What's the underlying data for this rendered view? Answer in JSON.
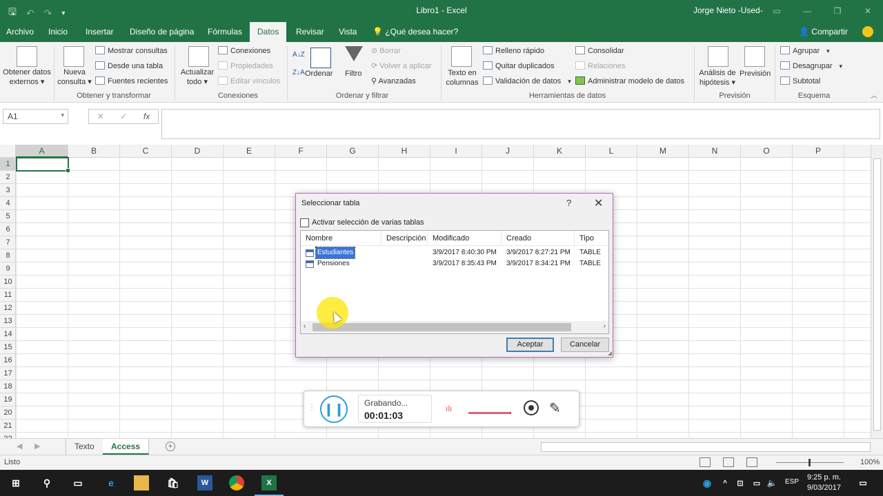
{
  "window": {
    "title": "Libro1  -  Excel",
    "user": "Jorge Nieto -Used-"
  },
  "menu": {
    "tabs": [
      "Archivo",
      "Inicio",
      "Insertar",
      "Diseño de página",
      "Fórmulas",
      "Datos",
      "Revisar",
      "Vista"
    ],
    "active_tab": "Datos",
    "tell_me": "¿Qué desea hacer?",
    "share": "Compartir"
  },
  "ribbon": {
    "get_external": [
      "Obtener datos",
      "externos ▾"
    ],
    "new_query": [
      "Nueva",
      "consulta ▾"
    ],
    "show_queries": "Mostrar consultas",
    "from_table": "Desde una tabla",
    "recent_sources": "Fuentes recientes",
    "group_get_transform": "Obtener y transformar",
    "refresh_all": [
      "Actualizar",
      "todo ▾"
    ],
    "connections": "Conexiones",
    "properties": "Propiedades",
    "edit_links": "Editar vínculos",
    "group_connections": "Conexiones",
    "sort": "Ordenar",
    "filter": "Filtro",
    "clear": "Borrar",
    "reapply": "Volver a aplicar",
    "advanced": "Avanzadas",
    "group_sort_filter": "Ordenar y filtrar",
    "text_to_columns": [
      "Texto en",
      "columnas"
    ],
    "flash_fill": "Relleno rápido",
    "remove_duplicates": "Quitar duplicados",
    "data_validation": "Validación de datos",
    "consolidate": "Consolidar",
    "relationships": "Relaciones",
    "manage_model": "Administrar modelo de datos",
    "group_data_tools": "Herramientas de datos",
    "what_if": [
      "Análisis de",
      "hipótesis ▾"
    ],
    "forecast_sheet": "Previsión",
    "group_forecast": "Previsión",
    "group": "Agrupar",
    "ungroup": "Desagrupar",
    "subtotal": "Subtotal",
    "group_outline": "Esquema"
  },
  "formula_bar": {
    "name_box": "A1",
    "fx": "fx",
    "content": ""
  },
  "grid": {
    "columns": [
      "A",
      "B",
      "C",
      "D",
      "E",
      "F",
      "G",
      "H",
      "I",
      "J",
      "K",
      "L",
      "M",
      "N",
      "O",
      "P"
    ],
    "rows": [
      "1",
      "2",
      "3",
      "4",
      "5",
      "6",
      "7",
      "8",
      "9",
      "10",
      "11",
      "12",
      "13",
      "14",
      "15",
      "16",
      "17",
      "18",
      "19",
      "20",
      "21",
      "22"
    ]
  },
  "sheets": {
    "tabs": [
      "Texto",
      "Access"
    ],
    "active": "Access"
  },
  "status": {
    "text": "Listo",
    "zoom": "100%"
  },
  "dialog": {
    "title": "Seleccionar tabla",
    "help": "?",
    "close": "✕",
    "multi_select_label": "Activar selección de varias tablas",
    "multi_select_checked": false,
    "columns": [
      "Nombre",
      "Descripción",
      "Modificado",
      "Creado",
      "Tipo"
    ],
    "rows": [
      {
        "name": "Estudiantes",
        "description": "",
        "modified": "3/9/2017 8:40:30 PM",
        "created": "3/9/2017 8:27:21 PM",
        "type": "TABLE",
        "selected": true
      },
      {
        "name": "Pensiones",
        "description": "",
        "modified": "3/9/2017 8:35:43 PM",
        "created": "3/9/2017 8:34:21 PM",
        "type": "TABLE",
        "selected": false
      }
    ],
    "ok": "Aceptar",
    "cancel": "Cancelar"
  },
  "recorder": {
    "status": "Grabando...",
    "time": "00:01:03"
  },
  "taskbar": {
    "language": "ESP",
    "time": "9:25 p. m.",
    "date": "9/03/2017"
  },
  "colors": {
    "excel_green": "#217346",
    "selection_blue": "#3875d7",
    "dialog_border": "#b66cb0"
  }
}
